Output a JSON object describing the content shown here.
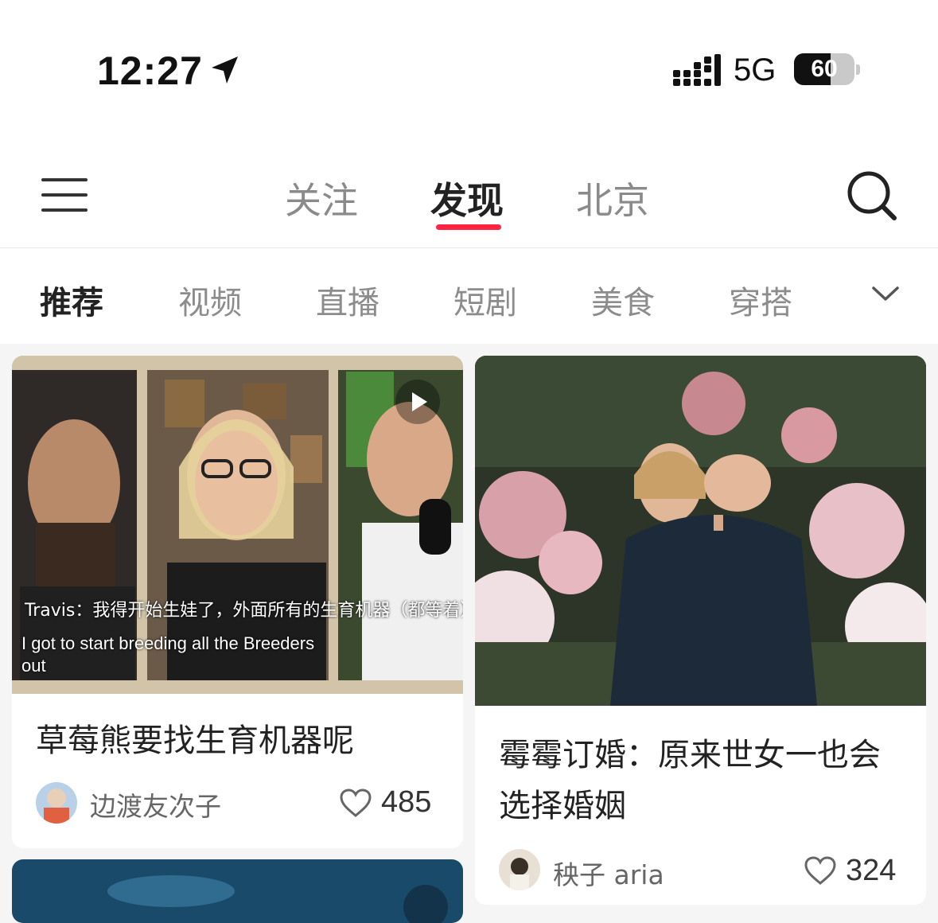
{
  "status_bar": {
    "time": "12:27",
    "network": "5G",
    "battery": "60",
    "battery_level": 0.6
  },
  "top_tabs": [
    {
      "label": "关注"
    },
    {
      "label": "发现"
    },
    {
      "label": "北京"
    }
  ],
  "categories": [
    {
      "label": "推荐"
    },
    {
      "label": "视频"
    },
    {
      "label": "直播"
    },
    {
      "label": "短剧"
    },
    {
      "label": "美食"
    },
    {
      "label": "穿搭"
    }
  ],
  "feed": [
    {
      "title": "草莓熊要找生育机器呢",
      "author": "边渡友次子",
      "likes": "485",
      "subtitle_cn": "Travis：我得开始生娃了，外面所有的生育机器（都等着）",
      "subtitle_en": "I got to start breeding all the Breeders out"
    },
    {
      "title": "霉霉订婚：原来世女一也会选择婚姻",
      "author": "秧子 aria",
      "likes": "324"
    }
  ],
  "colors": {
    "accent": "#ff2442",
    "text_primary": "#222222",
    "text_secondary": "#8c8c8c"
  },
  "icons": [
    "location-arrow-icon",
    "signal-icon",
    "menu-icon",
    "search-icon",
    "chevron-down-icon",
    "play-icon",
    "heart-icon"
  ]
}
